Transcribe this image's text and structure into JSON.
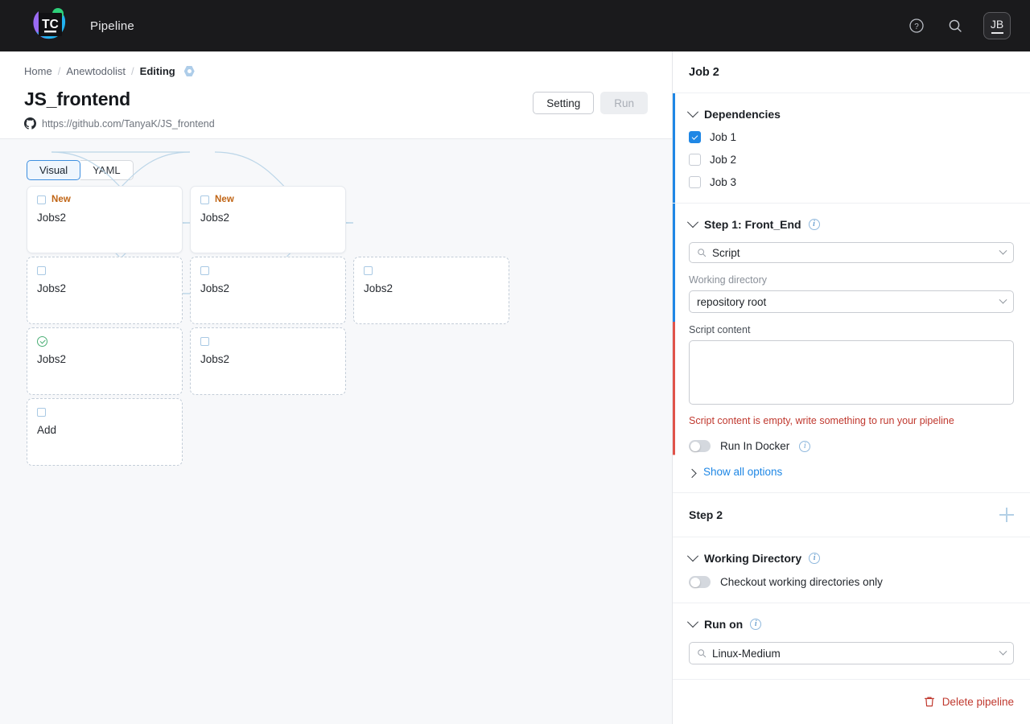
{
  "topbar": {
    "logo_text": "TC",
    "app_title": "Pipeline",
    "help_icon": "help-circle-icon",
    "search_icon": "search-icon",
    "avatar_initials": "JB"
  },
  "breadcrumb": {
    "items": [
      {
        "label": "Home",
        "current": false
      },
      {
        "label": "Anewtodolist",
        "current": false
      },
      {
        "label": "Editing",
        "current": true
      }
    ],
    "separator": "/",
    "status_badge_icon": "running-hexagon-icon"
  },
  "header": {
    "title": "JS_frontend",
    "repo_icon": "github-icon",
    "repo_url": "https://github.com/TanyaK/JS_frontend",
    "setting_label": "Setting",
    "run_label": "Run"
  },
  "view_tabs": {
    "options": [
      "Visual",
      "YAML"
    ],
    "selected": "Visual"
  },
  "graph": {
    "nodes": [
      {
        "label": "Jobs2",
        "badge": "New",
        "status_icon": "square-icon",
        "style": "solid",
        "col": 0,
        "row": 0
      },
      {
        "label": "Jobs2",
        "badge": "New",
        "status_icon": "square-icon",
        "style": "solid",
        "col": 1,
        "row": 0
      },
      {
        "label": "Jobs2",
        "badge": "",
        "status_icon": "square-icon",
        "style": "dashed",
        "col": 0,
        "row": 1
      },
      {
        "label": "Jobs2",
        "badge": "",
        "status_icon": "square-icon",
        "style": "dashed",
        "col": 1,
        "row": 1
      },
      {
        "label": "Jobs2",
        "badge": "",
        "status_icon": "square-icon",
        "style": "dashed",
        "col": 2,
        "row": 1
      },
      {
        "label": "Jobs2",
        "badge": "",
        "status_icon": "check-circle-icon",
        "style": "dashed",
        "col": 0,
        "row": 2
      },
      {
        "label": "Jobs2",
        "badge": "",
        "status_icon": "square-icon",
        "style": "dashed",
        "col": 1,
        "row": 2
      },
      {
        "label": "Add",
        "badge": "",
        "status_icon": "square-icon",
        "style": "dashed",
        "col": 0,
        "row": 3
      }
    ]
  },
  "panel": {
    "title": "Job 2",
    "dependencies": {
      "heading": "Dependencies",
      "items": [
        {
          "label": "Job 1",
          "checked": true
        },
        {
          "label": "Job 2",
          "checked": false
        },
        {
          "label": "Job 3",
          "checked": false
        }
      ],
      "accent_color": "#1f87e5"
    },
    "step1": {
      "heading": "Step 1: Front_End",
      "runner_value": "Script",
      "working_directory_label": "Working directory",
      "working_directory_value": "repository root",
      "script_content_label": "Script content",
      "script_content_value": "",
      "error": "Script content is empty, write something to run your pipeline",
      "run_in_docker_label": "Run In Docker",
      "run_in_docker_on": false,
      "show_all_options_label": "Show all options",
      "accent_color_top": "#1f87e5",
      "accent_color_bottom": "#e0534a"
    },
    "step2": {
      "heading": "Step 2",
      "add_icon": "plus-icon"
    },
    "working_directory": {
      "heading": "Working Directory",
      "checkout_label": "Checkout working directories only",
      "checkout_on": false
    },
    "run_on": {
      "heading": "Run on",
      "value": "Linux-Medium"
    },
    "footer": {
      "delete_label": "Delete pipeline",
      "delete_icon": "trash-icon",
      "color": "#c0392f"
    }
  }
}
